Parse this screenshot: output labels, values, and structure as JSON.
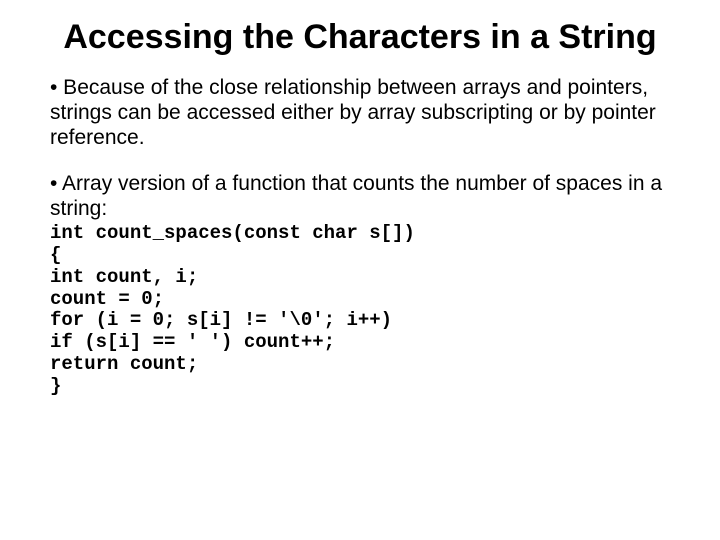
{
  "title": "Accessing the Characters in a String",
  "paragraphs": {
    "p1": "• Because of the close relationship between arrays and pointers, strings can be accessed either by array subscripting or by pointer reference.",
    "p2": "• Array version of a function that counts the number of spaces in a string:"
  },
  "code": "int count_spaces(const char s[])\n{\nint count, i;\ncount = 0;\nfor (i = 0; s[i] != '\\0'; i++)\nif (s[i] == ' ') count++;\nreturn count;\n}"
}
